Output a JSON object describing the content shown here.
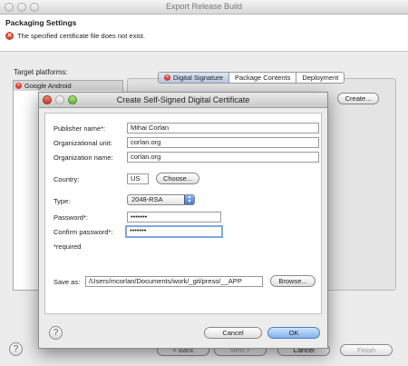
{
  "window": {
    "title": "Export Release Build"
  },
  "header": {
    "title": "Packaging Settings",
    "error": "The specified certificate file does not exist."
  },
  "target_platforms": {
    "label": "Target platforms:",
    "items": [
      "Google Android"
    ]
  },
  "tabs": [
    "Digital Signature",
    "Package Contents",
    "Deployment"
  ],
  "buttons": {
    "create": "Create...",
    "back": "< Back",
    "next": "Next >",
    "cancel": "Cancel",
    "finish": "Finish"
  },
  "help_symbol": "?",
  "dialog": {
    "title": "Create Self-Signed Digital Certificate",
    "fields": {
      "publisher": {
        "label": "Publisher name*:",
        "value": "Mihai Corlan"
      },
      "org_unit": {
        "label": "Organizational unit:",
        "value": "corlan.org"
      },
      "org_name": {
        "label": "Organization name:",
        "value": "corlan.org"
      },
      "country": {
        "label": "Country:",
        "value": "US",
        "choose_button": "Choose..."
      },
      "type": {
        "label": "Type:",
        "value": "2048-RSA"
      },
      "password": {
        "label": "Password*:",
        "value": "•••••••"
      },
      "confirm": {
        "label": "Confirm password*:",
        "value": "•••••••"
      }
    },
    "required_note": "*required",
    "save_as": {
      "label": "Save as:",
      "value": "/Users/mcorlan/Documents/work/_git/preso/__APP",
      "browse_button": "Browse..."
    },
    "buttons": {
      "cancel": "Cancel",
      "ok": "OK"
    }
  }
}
